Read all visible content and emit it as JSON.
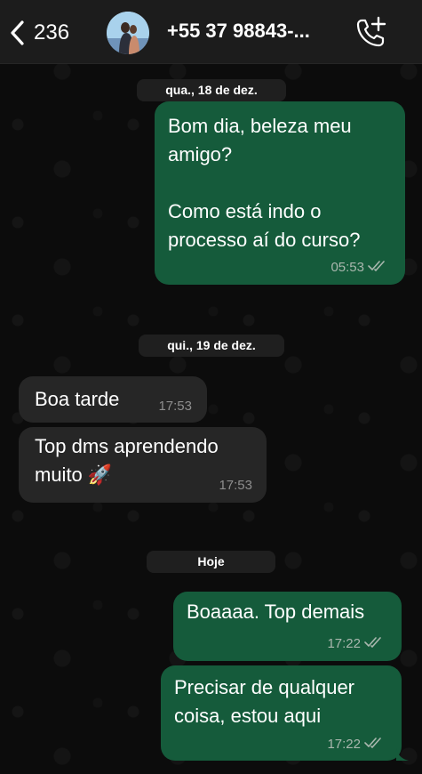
{
  "header": {
    "back_count": "236",
    "contact": "+55 37 98843-..."
  },
  "dates": {
    "first": "qua., 18 de dez.",
    "second": "qui., 19 de dez.",
    "third": "Hoje"
  },
  "messages": [
    {
      "direction": "out",
      "text": "Bom dia, beleza meu\namigo?\n\nComo está indo o\nprocesso aí do curso?",
      "time": "05:53",
      "status": "read"
    },
    {
      "direction": "in",
      "text": "Boa tarde",
      "time": "17:53"
    },
    {
      "direction": "in",
      "text": "Top dms aprendendo\nmuito 🚀",
      "time": "17:53"
    },
    {
      "direction": "out",
      "text": "Boaaaa. Top demais",
      "time": "17:22",
      "status": "read"
    },
    {
      "direction": "out",
      "text": "Precisar de qualquer\ncoisa, estou aqui",
      "time": "17:22",
      "status": "read"
    }
  ],
  "colors": {
    "outgoing_bubble": "#155b3b",
    "incoming_bubble": "#262626",
    "header_bg": "#1c1c1c"
  },
  "icons": [
    "chevron-left-icon",
    "call-add-icon",
    "double-check-icon"
  ]
}
